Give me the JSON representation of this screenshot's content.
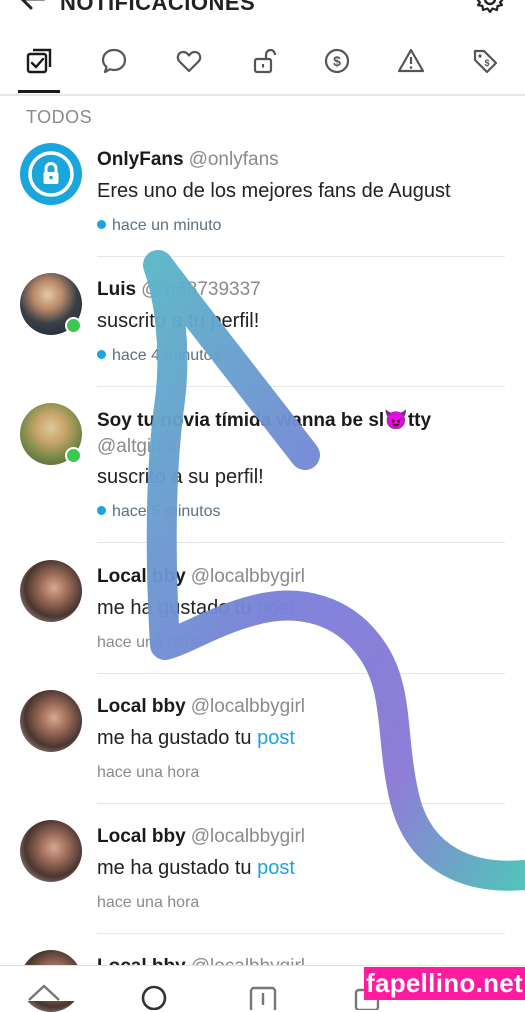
{
  "header": {
    "title": "NOTIFICACIONES"
  },
  "tabs": [
    "all-tab",
    "comments-tab",
    "likes-tab",
    "subscriptions-tab",
    "tips-tab",
    "alerts-tab",
    "promotions-tab"
  ],
  "section_label": "TODOS",
  "notifications": [
    {
      "name": "OnlyFans",
      "handle": "@onlyfans",
      "message": "Eres uno de los mejores fans de August",
      "link": "",
      "time": "hace un minuto"
    },
    {
      "name": "Luis",
      "handle": "@ u68739337",
      "message": "suscrito a tu perfil!",
      "link": "",
      "time": "hace 4 minutos"
    },
    {
      "name": "Soy tu novia tímida wanna be sl😈tty",
      "handle": "@altgirlol",
      "message": "suscrito a su perfil!",
      "link": "",
      "time": "hace 5 minutos"
    },
    {
      "name": "Local bby",
      "handle": "@localbbygirl",
      "message": "me ha gustado tu ",
      "link": "post",
      "time": "hace una hora"
    },
    {
      "name": "Local bby",
      "handle": "@localbbygirl",
      "message": "me ha gustado tu ",
      "link": "post",
      "time": "hace una hora"
    },
    {
      "name": "Local bby",
      "handle": "@localbbygirl",
      "message": "me ha gustado tu ",
      "link": "post",
      "time": "hace una hora"
    },
    {
      "name": "Local bby",
      "handle": "@localbbygirl",
      "message": "",
      "link": "",
      "time": ""
    }
  ],
  "watermark": "fapellino.net",
  "colors": {
    "accent": "#1aa5dc",
    "online": "#3ec74f",
    "watermark_bg": "#ff1aa0"
  }
}
